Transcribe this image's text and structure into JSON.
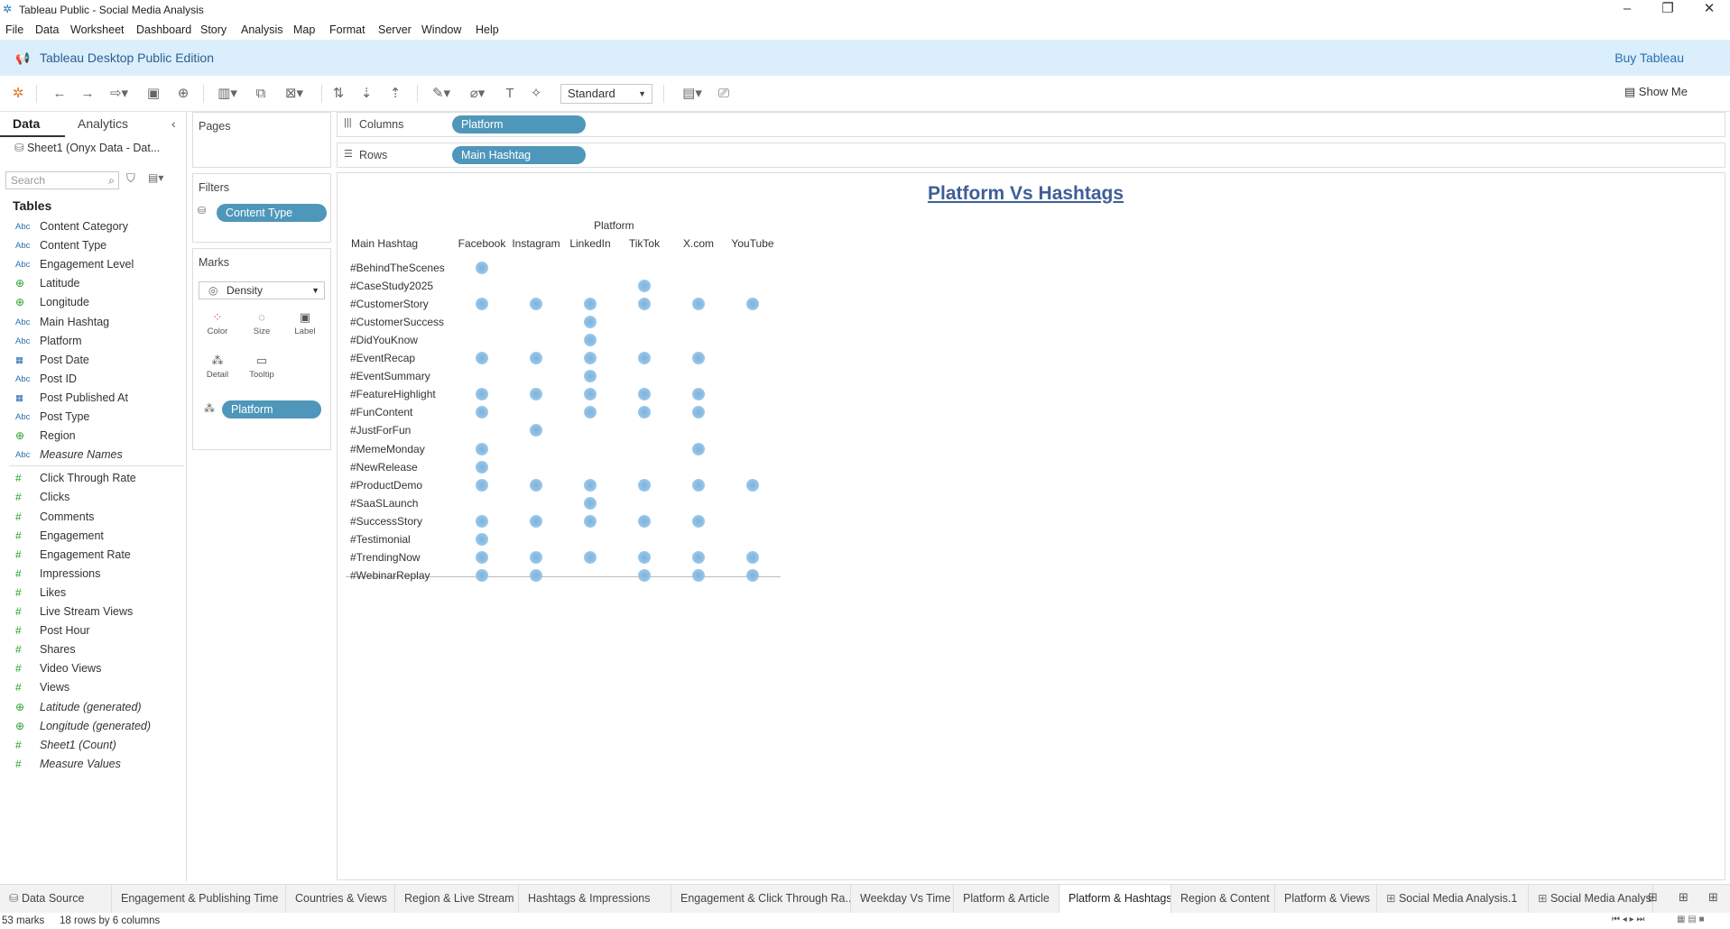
{
  "window": {
    "title": "Tableau Public - Social Media Analysis"
  },
  "menu": [
    "File",
    "Data",
    "Worksheet",
    "Dashboard",
    "Story",
    "Analysis",
    "Map",
    "Format",
    "Server",
    "Window",
    "Help"
  ],
  "banner": {
    "edition": "Tableau Desktop Public Edition",
    "buy": "Buy Tableau"
  },
  "toolbar": {
    "fit": "Standard",
    "show_me": "Show Me"
  },
  "datapane": {
    "tabs": [
      "Data",
      "Analytics"
    ],
    "source": "Sheet1 (Onyx Data - Dat...",
    "search_placeholder": "Search",
    "tables_heading": "Tables",
    "dimensions": [
      {
        "icon": "Abc",
        "name": "Content Category"
      },
      {
        "icon": "Abc",
        "name": "Content Type"
      },
      {
        "icon": "Abc",
        "name": "Engagement Level"
      },
      {
        "icon": "globe",
        "name": "Latitude"
      },
      {
        "icon": "globe",
        "name": "Longitude"
      },
      {
        "icon": "Abc",
        "name": "Main Hashtag"
      },
      {
        "icon": "Abc",
        "name": "Platform"
      },
      {
        "icon": "calendar",
        "name": "Post Date"
      },
      {
        "icon": "Abc",
        "name": "Post ID"
      },
      {
        "icon": "datetime",
        "name": "Post Published At"
      },
      {
        "icon": "Abc",
        "name": "Post Type"
      },
      {
        "icon": "globe",
        "name": "Region"
      },
      {
        "icon": "Abc",
        "name": "Measure Names",
        "italic": true
      }
    ],
    "measures": [
      {
        "icon": "#",
        "name": "Click Through Rate"
      },
      {
        "icon": "#",
        "name": "Clicks"
      },
      {
        "icon": "#",
        "name": "Comments"
      },
      {
        "icon": "#",
        "name": "Engagement"
      },
      {
        "icon": "#",
        "name": "Engagement Rate"
      },
      {
        "icon": "#",
        "name": "Impressions"
      },
      {
        "icon": "#",
        "name": "Likes"
      },
      {
        "icon": "#",
        "name": "Live Stream Views"
      },
      {
        "icon": "#",
        "name": "Post Hour"
      },
      {
        "icon": "#",
        "name": "Shares"
      },
      {
        "icon": "#",
        "name": "Video Views"
      },
      {
        "icon": "#",
        "name": "Views"
      },
      {
        "icon": "globe",
        "name": "Latitude (generated)",
        "italic": true
      },
      {
        "icon": "globe",
        "name": "Longitude (generated)",
        "italic": true
      },
      {
        "icon": "#",
        "name": "Sheet1 (Count)",
        "italic": true
      },
      {
        "icon": "#",
        "name": "Measure Values",
        "italic": true
      }
    ]
  },
  "pages": {
    "title": "Pages"
  },
  "filters": {
    "title": "Filters",
    "pill": "Content Type"
  },
  "marks": {
    "title": "Marks",
    "type": "Density",
    "buttons": [
      "Color",
      "Size",
      "Label",
      "Detail",
      "Tooltip"
    ],
    "pill": "Platform"
  },
  "shelves": {
    "columns_label": "Columns",
    "columns_pill": "Platform",
    "rows_label": "Rows",
    "rows_pill": "Main Hashtag"
  },
  "viz": {
    "title": "Platform Vs Hashtags",
    "column_group_header": "Platform",
    "row_header": "Main Hashtag",
    "platforms": [
      "Facebook",
      "Instagram",
      "LinkedIn",
      "TikTok",
      "X.com",
      "YouTube"
    ],
    "hashtags": [
      "#BehindTheScenes",
      "#CaseStudy2025",
      "#CustomerStory",
      "#CustomerSuccess",
      "#DidYouKnow",
      "#EventRecap",
      "#EventSummary",
      "#FeatureHighlight",
      "#FunContent",
      "#JustForFun",
      "#MemeMonday",
      "#NewRelease",
      "#ProductDemo",
      "#SaaSLaunch",
      "#SuccessStory",
      "#Testimonial",
      "#TrendingNow",
      "#WebinarReplay"
    ],
    "matrix": [
      [
        1,
        0,
        0,
        0,
        0,
        0
      ],
      [
        0,
        0,
        0,
        1,
        0,
        0
      ],
      [
        1,
        1,
        1,
        1,
        1,
        1
      ],
      [
        0,
        0,
        1,
        0,
        0,
        0
      ],
      [
        0,
        0,
        1,
        0,
        0,
        0
      ],
      [
        1,
        1,
        1,
        1,
        1,
        0
      ],
      [
        0,
        0,
        1,
        0,
        0,
        0
      ],
      [
        1,
        1,
        1,
        1,
        1,
        0
      ],
      [
        1,
        0,
        1,
        1,
        1,
        0
      ],
      [
        0,
        1,
        0,
        0,
        0,
        0
      ],
      [
        1,
        0,
        0,
        0,
        1,
        0
      ],
      [
        1,
        0,
        0,
        0,
        0,
        0
      ],
      [
        1,
        1,
        1,
        1,
        1,
        1
      ],
      [
        0,
        0,
        1,
        0,
        0,
        0
      ],
      [
        1,
        1,
        1,
        1,
        1,
        0
      ],
      [
        1,
        0,
        0,
        0,
        0,
        0
      ],
      [
        1,
        1,
        1,
        1,
        1,
        1
      ],
      [
        1,
        1,
        0,
        1,
        1,
        1
      ]
    ],
    "mark_color": "#8fbfe4"
  },
  "sheet_tabs": [
    {
      "label": "Data Source",
      "icon": "datasource"
    },
    {
      "label": "Engagement & Publishing Time"
    },
    {
      "label": "Countries & Views"
    },
    {
      "label": "Region & Live Stream"
    },
    {
      "label": "Hashtags & Impressions"
    },
    {
      "label": "Engagement & Click Through Ra..."
    },
    {
      "label": "Weekday Vs Time"
    },
    {
      "label": "Platform & Article"
    },
    {
      "label": "Platform & Hashtags",
      "active": true
    },
    {
      "label": "Region & Content"
    },
    {
      "label": "Platform & Views"
    },
    {
      "label": "Social Media Analysis.1",
      "icon": "dashboard"
    },
    {
      "label": "Social Media Analysis",
      "icon": "dashboard"
    }
  ],
  "status": {
    "marks": "53 marks",
    "dims": "18 rows by 6 columns"
  }
}
